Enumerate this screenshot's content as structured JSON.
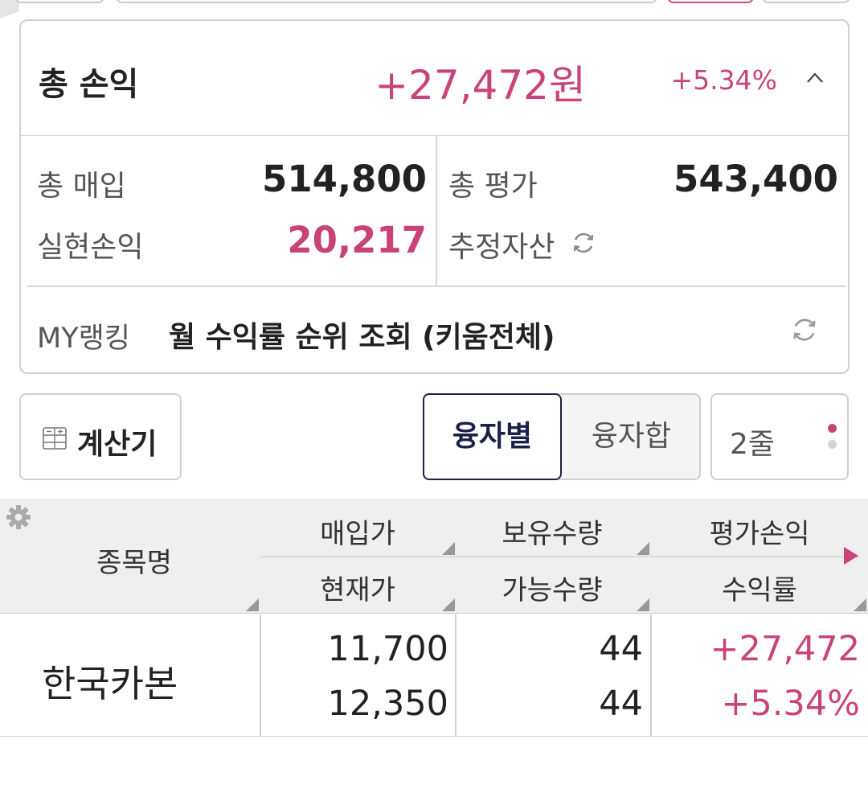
{
  "summary": {
    "title": "총 손익",
    "amount": "+27,472원",
    "percent": "+5.34%",
    "total_buy_label": "총 매입",
    "total_buy_value": "514,800",
    "total_eval_label": "총 평가",
    "total_eval_value": "543,400",
    "realized_label": "실현손익",
    "realized_value": "20,217",
    "estimated_label": "추정자산"
  },
  "ranking": {
    "label": "MY랭킹",
    "text": "월 수익률 순위 조회 (키움전체)"
  },
  "controls": {
    "calculator_label": "계산기",
    "tab_by_loan": "융자별",
    "tab_loan_sum": "융자합",
    "lines_label": "2줄"
  },
  "table": {
    "headers": {
      "name": "종목명",
      "buy_price": "매입가",
      "current_price": "현재가",
      "holding_qty": "보유수량",
      "available_qty": "가능수량",
      "eval_pl": "평가손익",
      "return_rate": "수익률"
    },
    "rows": [
      {
        "name": "한국카본",
        "buy_price": "11,700",
        "current_price": "12,350",
        "holding_qty": "44",
        "available_qty": "44",
        "eval_pl": "+27,472",
        "return_rate": "+5.34%"
      }
    ]
  },
  "colors": {
    "positive": "#c9437a",
    "selected_tab_border": "#1d2147"
  },
  "icons": [
    "chevron-up-icon",
    "refresh-icon",
    "calculator-icon",
    "gear-icon",
    "scroll-right-icon",
    "more-dots-icon"
  ]
}
